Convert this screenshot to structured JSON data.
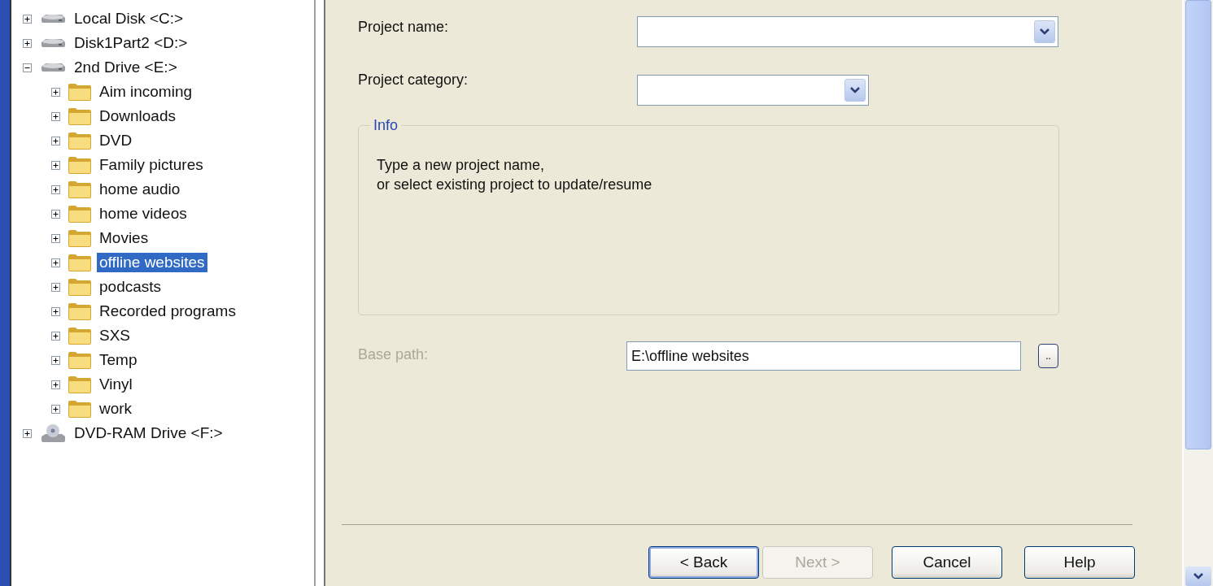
{
  "tree": [
    {
      "label": "Local Disk <C:>",
      "kind": "drive",
      "expanded": false,
      "selected": false
    },
    {
      "label": "Disk1Part2 <D:>",
      "kind": "drive",
      "expanded": false,
      "selected": false
    },
    {
      "label": "2nd Drive <E:>",
      "kind": "drive",
      "expanded": true,
      "selected": false,
      "children": [
        {
          "label": "Aim incoming",
          "kind": "folder",
          "expanded": false,
          "selected": false
        },
        {
          "label": "Downloads",
          "kind": "folder",
          "expanded": false,
          "selected": false
        },
        {
          "label": "DVD",
          "kind": "folder",
          "expanded": false,
          "selected": false
        },
        {
          "label": "Family pictures",
          "kind": "folder",
          "expanded": false,
          "selected": false
        },
        {
          "label": "home audio",
          "kind": "folder",
          "expanded": false,
          "selected": false
        },
        {
          "label": "home videos",
          "kind": "folder",
          "expanded": false,
          "selected": false
        },
        {
          "label": "Movies",
          "kind": "folder",
          "expanded": false,
          "selected": false
        },
        {
          "label": "offline websites",
          "kind": "folder",
          "expanded": false,
          "selected": true
        },
        {
          "label": "podcasts",
          "kind": "folder",
          "expanded": false,
          "selected": false
        },
        {
          "label": "Recorded programs",
          "kind": "folder",
          "expanded": false,
          "selected": false
        },
        {
          "label": "SXS",
          "kind": "folder",
          "expanded": false,
          "selected": false
        },
        {
          "label": "Temp",
          "kind": "folder",
          "expanded": false,
          "selected": false
        },
        {
          "label": "Vinyl",
          "kind": "folder",
          "expanded": false,
          "selected": false
        },
        {
          "label": "work",
          "kind": "folder",
          "expanded": false,
          "selected": false
        }
      ]
    },
    {
      "label": "DVD-RAM Drive <F:>",
      "kind": "dvd",
      "expanded": false,
      "selected": false
    }
  ],
  "form": {
    "project_name": {
      "label": "Project name:"
    },
    "project_category": {
      "label": "Project category:"
    },
    "info": {
      "title": "Info",
      "lines": [
        "Type a new project name,",
        "or select existing project to update/resume"
      ]
    },
    "base_path": {
      "label": "Base path:",
      "value": "E:\\offline websites",
      "disabled": true,
      "browse": ".."
    }
  },
  "buttons": [
    {
      "label": "< Back",
      "disabled": false,
      "default": true
    },
    {
      "label": "Next >",
      "disabled": true,
      "default": false
    },
    {
      "label": "Cancel",
      "disabled": false,
      "default": false
    },
    {
      "label": "Help",
      "disabled": false,
      "default": false
    }
  ]
}
